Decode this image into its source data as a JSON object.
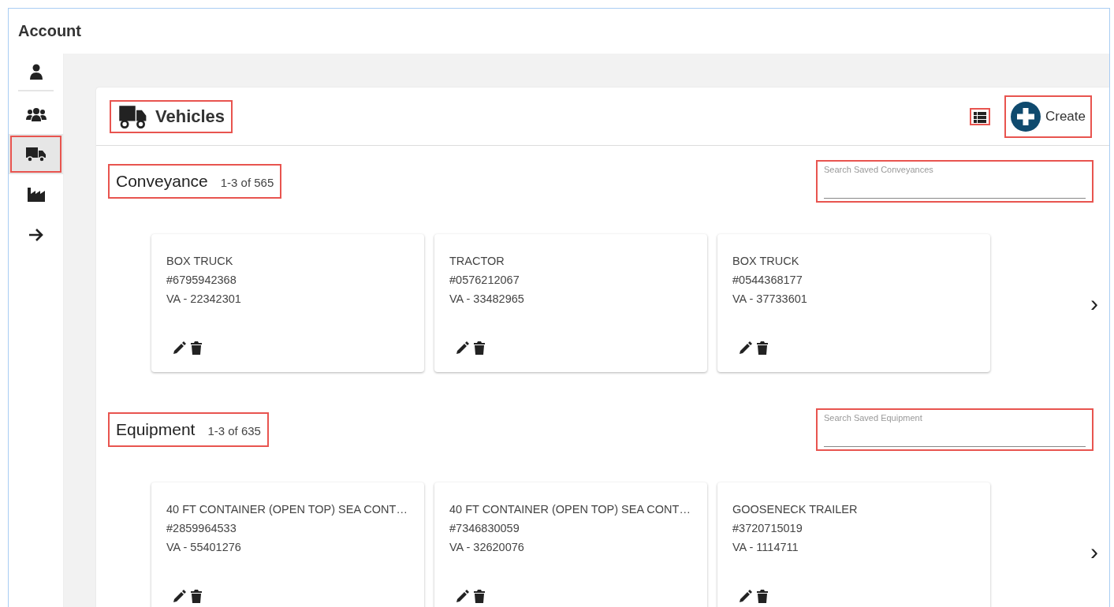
{
  "header": {
    "title": "Account"
  },
  "sidebar": {
    "items": [
      {
        "kind": "person",
        "selected": false,
        "highlighted": false
      },
      {
        "kind": "group",
        "selected": false,
        "highlighted": false
      },
      {
        "kind": "truck",
        "selected": true,
        "highlighted": true
      },
      {
        "kind": "factory",
        "selected": false,
        "highlighted": false
      },
      {
        "kind": "arrow",
        "selected": false,
        "highlighted": false
      }
    ]
  },
  "panel": {
    "title": "Vehicles",
    "title_highlighted": true,
    "list_view_highlighted": true,
    "create": {
      "label": "Create",
      "highlighted": true
    }
  },
  "sections": [
    {
      "title": "Conveyance",
      "count": "1-3 of 565",
      "highlighted": true,
      "search": {
        "placeholder": "Search Saved Conveyances",
        "highlighted": true
      },
      "next": "›",
      "cards": [
        {
          "type": "BOX TRUCK",
          "number": "#6795942368",
          "plate": "VA - 22342301"
        },
        {
          "type": "TRACTOR",
          "number": "#0576212067",
          "plate": "VA - 33482965"
        },
        {
          "type": "BOX TRUCK",
          "number": "#0544368177",
          "plate": "VA - 37733601"
        }
      ]
    },
    {
      "title": "Equipment",
      "count": "1-3 of 635",
      "highlighted": true,
      "search": {
        "placeholder": "Search Saved Equipment",
        "highlighted": true
      },
      "next": "›",
      "cards": [
        {
          "type": "40 FT CONTAINER (OPEN TOP) SEA CONT…",
          "number": "#2859964533",
          "plate": "VA - 55401276"
        },
        {
          "type": "40 FT CONTAINER (OPEN TOP) SEA CONT…",
          "number": "#7346830059",
          "plate": "VA - 32620076"
        },
        {
          "type": "GOOSENECK TRAILER",
          "number": "#3720715019",
          "plate": "VA - 1114711"
        }
      ]
    }
  ]
}
